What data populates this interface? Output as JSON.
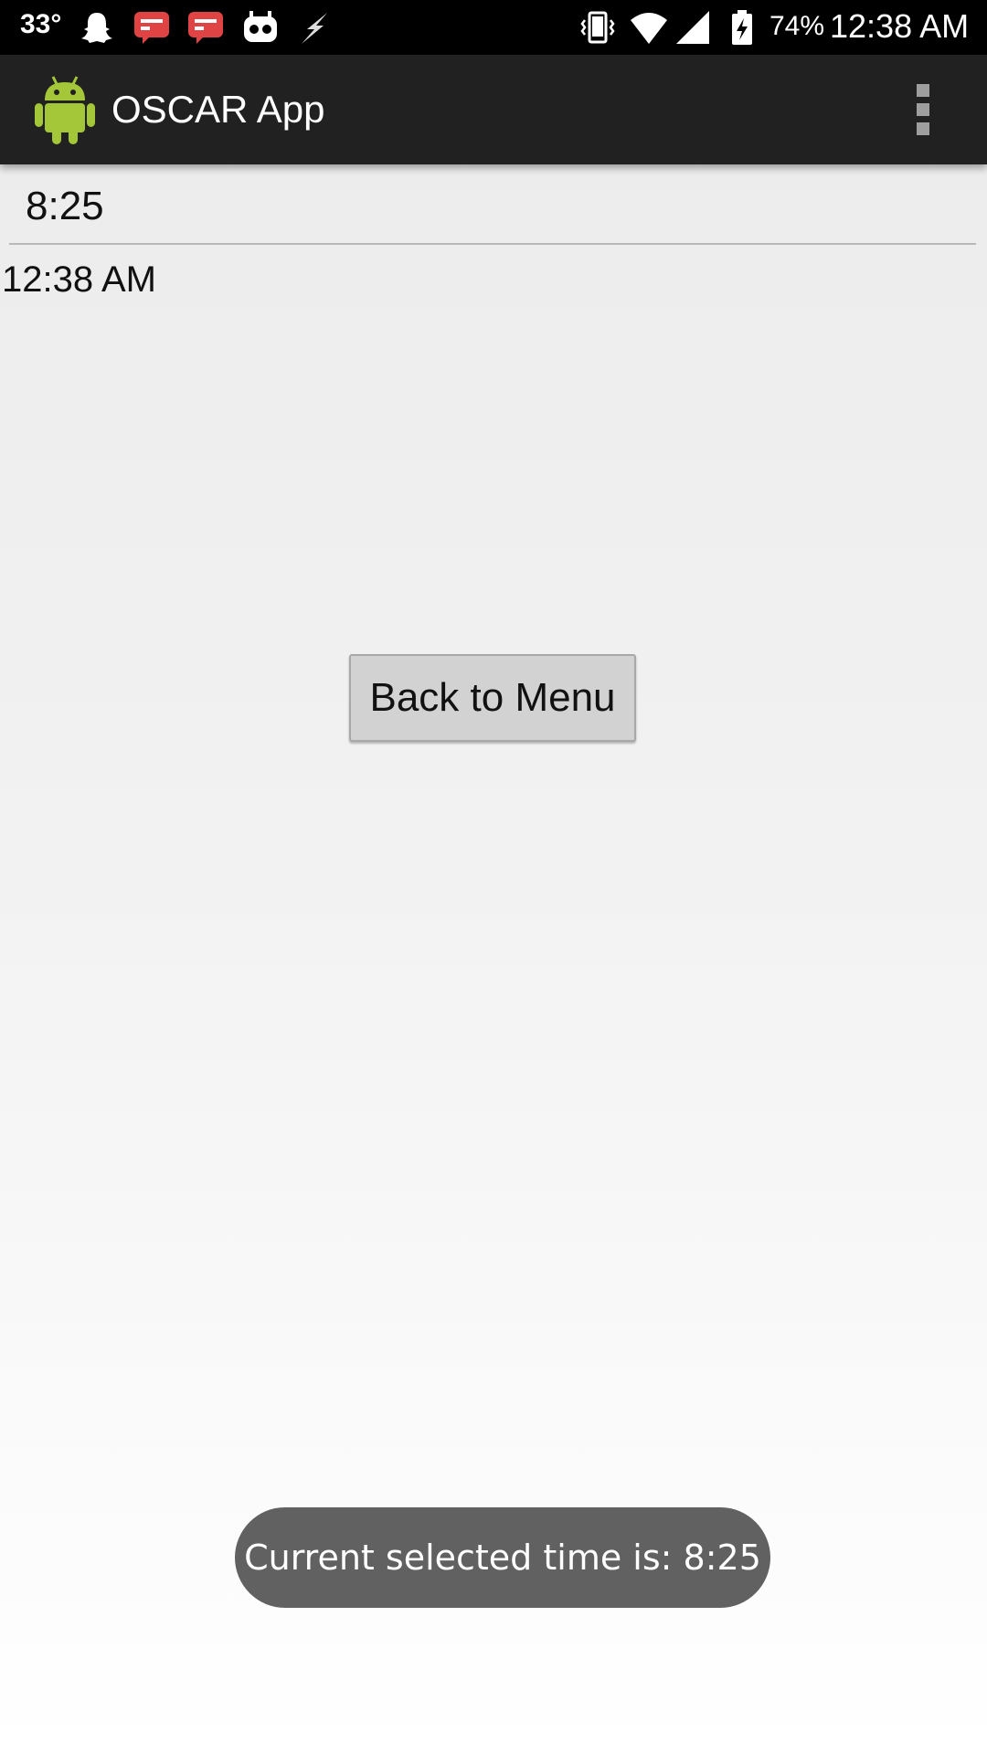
{
  "status_bar": {
    "temperature": "33°",
    "battery_percent": "74%",
    "time": "12:38 AM",
    "left_icons": [
      "snapchat-ghost-icon",
      "chat-notification-icon",
      "chat-notification-icon",
      "cyanogen-mod-icon",
      "flash-icon"
    ],
    "right_icons": [
      "vibrate-icon",
      "wifi-icon",
      "cell-signal-icon",
      "battery-charging-icon"
    ]
  },
  "action_bar": {
    "title": "OSCAR App",
    "logo_icon": "android-robot-icon",
    "menu_icon": "overflow-menu-icon"
  },
  "main": {
    "time_input_value": "8:25",
    "current_time_label": "12:38 AM",
    "back_button_label": "Back to Menu"
  },
  "toast": {
    "message": "Current selected time is: 8:25"
  },
  "colors": {
    "action_bar_bg": "#212121",
    "toast_bg": "#616161",
    "button_bg": "#d2d2d2",
    "android_green": "#a4c639",
    "notification_red": "#e04343"
  }
}
